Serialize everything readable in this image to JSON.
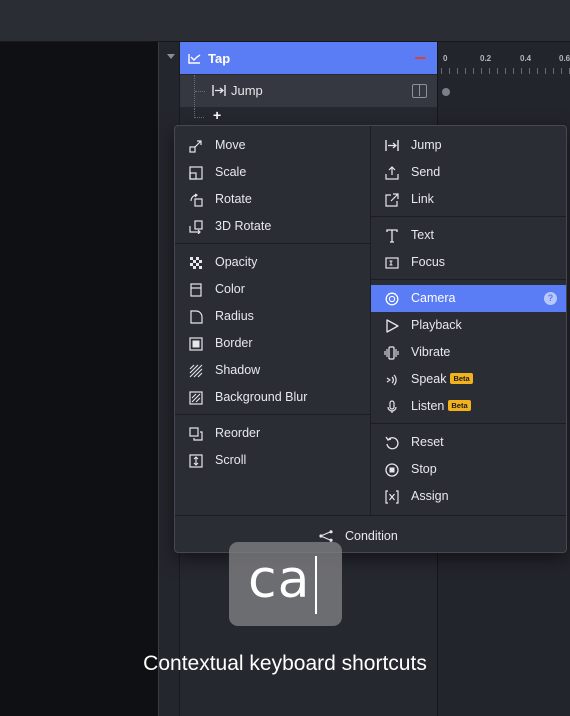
{
  "layer": {
    "tap_label": "Tap",
    "jump_label": "Jump",
    "add_label": "+"
  },
  "timeline": {
    "ticks": [
      "0",
      "0.2",
      "0.4",
      "0.6"
    ]
  },
  "menu": {
    "left_items": [
      {
        "label": "Move",
        "icon": "move-icon"
      },
      {
        "label": "Scale",
        "icon": "scale-icon"
      },
      {
        "label": "Rotate",
        "icon": "rotate-icon"
      },
      {
        "label": "3D Rotate",
        "icon": "rotate-3d-icon"
      },
      {
        "label": "Opacity",
        "icon": "opacity-icon"
      },
      {
        "label": "Color",
        "icon": "color-icon"
      },
      {
        "label": "Radius",
        "icon": "radius-icon"
      },
      {
        "label": "Border",
        "icon": "border-icon"
      },
      {
        "label": "Shadow",
        "icon": "shadow-icon"
      },
      {
        "label": "Background Blur",
        "icon": "background-blur-icon"
      },
      {
        "label": "Reorder",
        "icon": "reorder-icon"
      },
      {
        "label": "Scroll",
        "icon": "scroll-icon"
      }
    ],
    "right_items": [
      {
        "label": "Jump",
        "icon": "jump-icon"
      },
      {
        "label": "Send",
        "icon": "send-icon"
      },
      {
        "label": "Link",
        "icon": "link-icon"
      },
      {
        "label": "Text",
        "icon": "text-icon"
      },
      {
        "label": "Focus",
        "icon": "focus-icon"
      },
      {
        "label": "Camera",
        "icon": "camera-icon",
        "selected": true,
        "help": "?"
      },
      {
        "label": "Playback",
        "icon": "playback-icon"
      },
      {
        "label": "Vibrate",
        "icon": "vibrate-icon"
      },
      {
        "label": "Speak",
        "icon": "speak-icon",
        "badge": "Beta"
      },
      {
        "label": "Listen",
        "icon": "listen-icon",
        "badge": "Beta"
      },
      {
        "label": "Reset",
        "icon": "reset-icon"
      },
      {
        "label": "Stop",
        "icon": "stop-icon"
      },
      {
        "label": "Assign",
        "icon": "assign-icon"
      }
    ],
    "footer_label": "Condition"
  },
  "keystroke": {
    "typed": "ca"
  },
  "caption": "Contextual keyboard shortcuts",
  "colors": {
    "accent": "#5a7cf5",
    "beta": "#f2b21c",
    "background": "#1f2026"
  }
}
